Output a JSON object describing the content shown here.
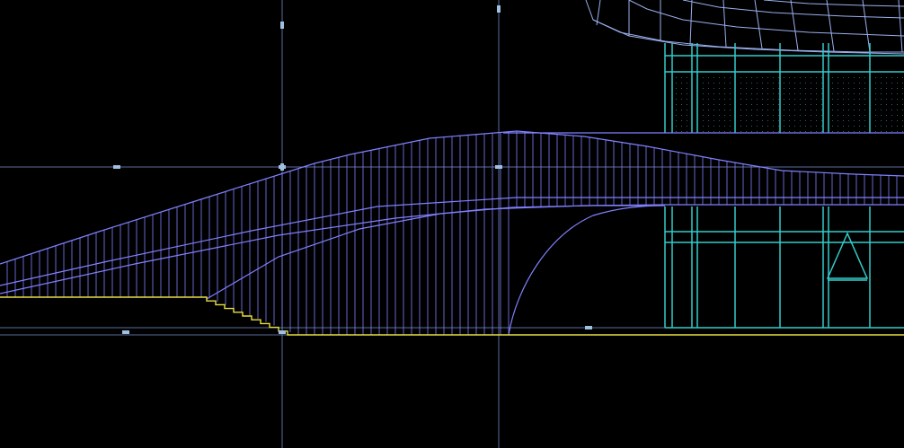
{
  "drawing": {
    "view": "cad-elevation",
    "background_color": "#000000",
    "colors": {
      "grid": "#5b6c9c",
      "roof_mesh": "#9ab0ee",
      "canopy": "#8080ff",
      "glazing": "#33cccc",
      "ground": "#e8e040",
      "marker": "#a0c0e0"
    },
    "labels": []
  }
}
